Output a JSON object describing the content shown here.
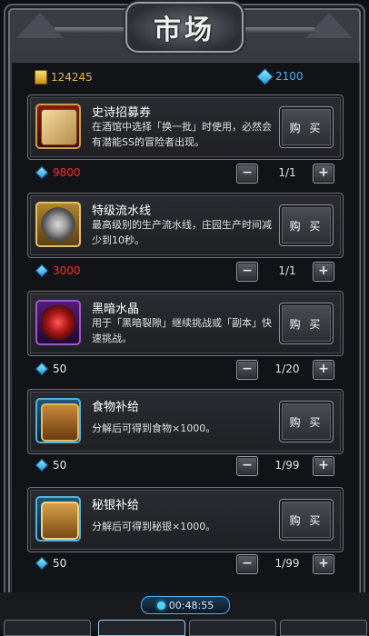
{
  "title": "市场",
  "currency": {
    "gold": "124245",
    "gems": "2100"
  },
  "buy_label": "购 买",
  "items": [
    {
      "name": "史诗招募券",
      "desc": "在酒馆中选择「换一批」时使用，必然会有潜能SS的冒险者出现。",
      "price": "9800",
      "price_color": "#ff2a2a",
      "qty": "1/1"
    },
    {
      "name": "特级流水线",
      "desc": "最高级别的生产流水线，庄园生产时间减少到10秒。",
      "price": "3000",
      "price_color": "#ff2a2a",
      "qty": "1/1"
    },
    {
      "name": "黑暗水晶",
      "desc": "用于「黑暗裂隙」继续挑战或「副本」快速挑战。",
      "price": "50",
      "price_color": "#e8e8e8",
      "qty": "1/20"
    },
    {
      "name": "食物补给",
      "desc": "分解后可得到食物×1000。",
      "price": "50",
      "price_color": "#e8e8e8",
      "qty": "1/99"
    },
    {
      "name": "秘银补给",
      "desc": "分解后可得到秘银×1000。",
      "price": "50",
      "price_color": "#e8e8e8",
      "qty": "1/99"
    }
  ],
  "item_icons": [
    "scroll-icon",
    "gear-icon",
    "crystal-icon",
    "chest-icon",
    "chest-icon"
  ],
  "timer": "00:48:55"
}
